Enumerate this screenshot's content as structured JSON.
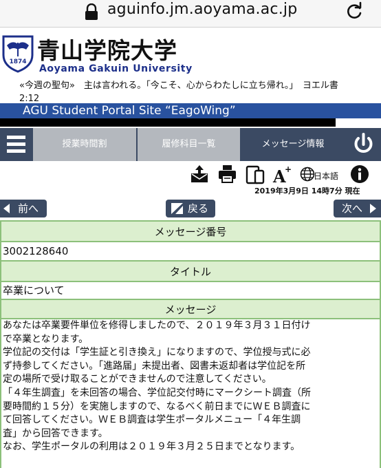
{
  "browser": {
    "url": "aguinfo.jm.aoyama.ac.jp"
  },
  "header": {
    "logo_text": "1874",
    "title_ja": "青山学院大学",
    "title_en": "Aoyama Gakuin University",
    "verse_line1": "«今週の聖句»　主は言われる。「今こそ、心からわたしに立ち帰れ。」　ヨエル書",
    "verse_line2": "2:12"
  },
  "banner": {
    "title": "AGU Student Portal Site “EagoWing”"
  },
  "nav": {
    "tabs": [
      {
        "label": "授業時間割"
      },
      {
        "label": "履修科目一覧"
      },
      {
        "label": "メッセージ情報"
      }
    ]
  },
  "toolbar": {
    "language_label": "日本語",
    "timestamp": "2019年3月9日 14時7分 現在"
  },
  "pager": {
    "prev_label": "前へ",
    "back_label": "戻る",
    "next_label": "次へ"
  },
  "message": {
    "number_header": "メッセージ番号",
    "number_value": "3002128640",
    "title_header": "タイトル",
    "title_value": "卒業について",
    "body_header": "メッセージ",
    "body_lines": [
      "あなたは卒業要件単位を修得しましたので、２０１９年３月３１日付け",
      "で卒業となります。",
      "学位記の交付は「学生証と引き換え」になりますので、学位授与式に必",
      "ず持参してください。「進路届」未提出者、図書未返却者は学位記を所",
      "定の場所で受け取ることができませんので注意してください。",
      "「４年生調査」を未回答の場合、学位記交付時にマークシート調査（所",
      "要時間約１５分）を実施しますので、なるべく前日までにＷＥＢ調査に",
      "て回答してください。ＷＥＢ調査は学生ポータルメニュー「４年生調",
      "査」から回答できます。",
      "なお、学生ポータルの利用は２０１９年３月２５日までとなります。"
    ]
  },
  "icons": [
    "lock-icon",
    "reload-icon",
    "crest-logo",
    "menu-icon",
    "logout-icon",
    "mail-tray-icon",
    "printer-icon",
    "mobile-devices-icon",
    "font-size-icon",
    "globe-icon",
    "info-icon",
    "chevron-left-icon",
    "edit-icon",
    "chevron-right-icon"
  ],
  "colors": {
    "banner": "#29529f",
    "nav": "#3b4a63",
    "nav_inactive": "#b4b8be",
    "table_border": "#8cc07a",
    "table_header": "#dcefcf",
    "english_title": "#1c2f8a"
  }
}
